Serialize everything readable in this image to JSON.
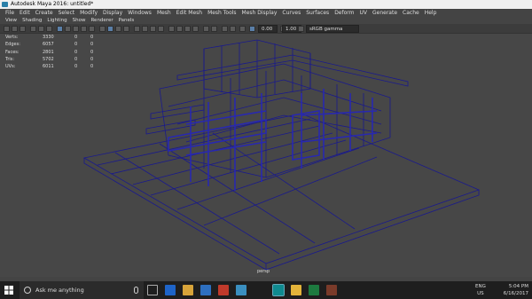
{
  "window": {
    "title": "Autodesk Maya 2016: untitled*"
  },
  "menubar": [
    "File",
    "Edit",
    "Create",
    "Select",
    "Modify",
    "Display",
    "Windows",
    "Mesh",
    "Edit Mesh",
    "Mesh Tools",
    "Mesh Display",
    "Curves",
    "Surfaces",
    "Deform",
    "UV",
    "Generate",
    "Cache",
    "Help"
  ],
  "view_menu": [
    "View",
    "Shading",
    "Lighting",
    "Show",
    "Renderer",
    "Panels"
  ],
  "toolbar": {
    "field_a": "0.00",
    "field_b": "1.00",
    "colorspace": "sRGB gamma"
  },
  "hud": [
    {
      "label": "Verts:",
      "v1": "3330",
      "v2": "0",
      "v3": "0"
    },
    {
      "label": "Edges:",
      "v1": "6057",
      "v2": "0",
      "v3": "0"
    },
    {
      "label": "Faces:",
      "v1": "2801",
      "v2": "0",
      "v3": "0"
    },
    {
      "label": "Tris:",
      "v1": "5702",
      "v2": "0",
      "v3": "0"
    },
    {
      "label": "UVs:",
      "v1": "6011",
      "v2": "0",
      "v3": "0"
    }
  ],
  "camera": "persp",
  "taskbar": {
    "search_placeholder": "Ask me anything",
    "lang": "ENG",
    "region": "US",
    "time": "5:04 PM",
    "date": "6/16/2017"
  },
  "colors": {
    "wire": "#1a1a8c",
    "viewport_bg": "#474747",
    "accent": "#5a7fa8"
  }
}
